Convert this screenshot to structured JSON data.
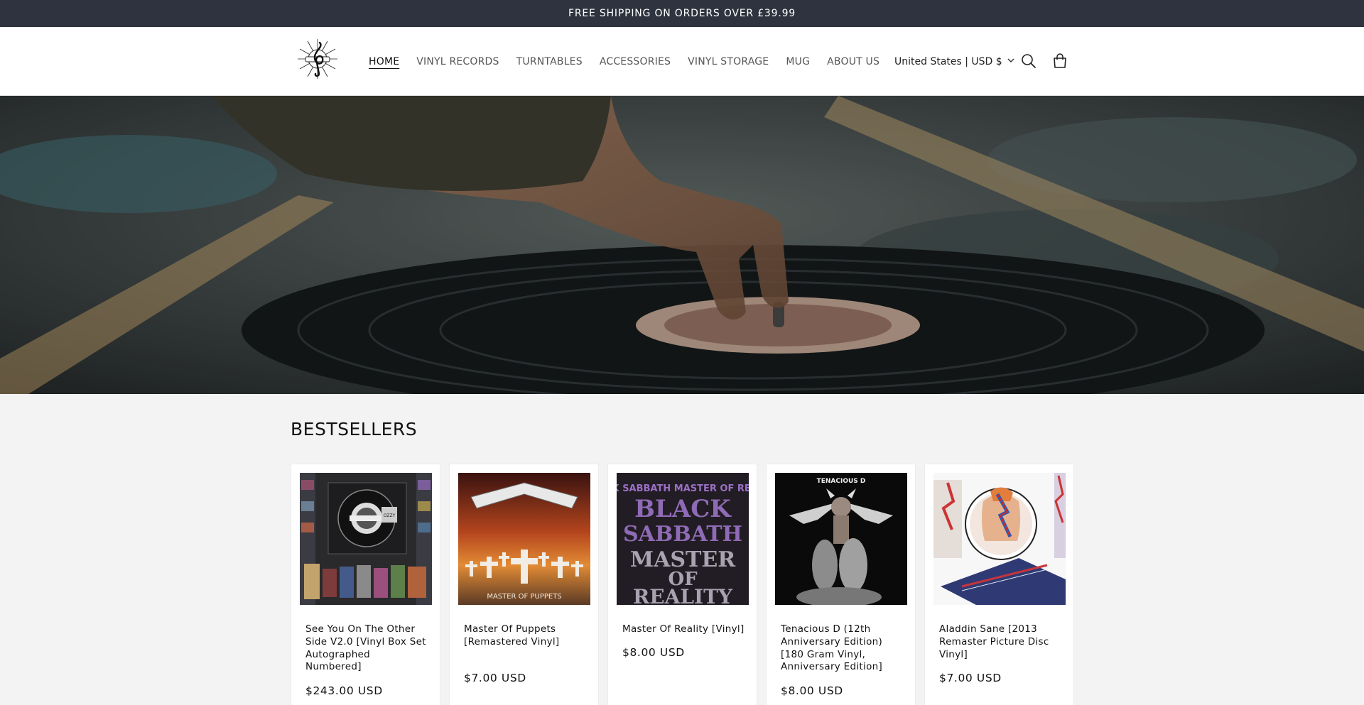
{
  "announcement": "FREE SHIPPING ON ORDERS OVER £39.99",
  "nav": {
    "items": [
      {
        "label": "HOME",
        "active": true
      },
      {
        "label": "VINYL RECORDS"
      },
      {
        "label": "TURNTABLES"
      },
      {
        "label": "ACCESSORIES"
      },
      {
        "label": "VINYL STORAGE"
      },
      {
        "label": "MUG"
      },
      {
        "label": "ABOUT US"
      }
    ]
  },
  "header": {
    "country": "United States | USD $",
    "icons": [
      "music-note-logo",
      "chevron-down-icon",
      "search-icon",
      "cart-icon"
    ]
  },
  "bestsellers": {
    "heading": "BESTSELLERS",
    "products": [
      {
        "title": "See You On The Other Side V2.0 [Vinyl Box Set Autographed Numbered]",
        "price": "$243.00 USD",
        "cover_text": "OZZY"
      },
      {
        "title": "Master Of Puppets [Remastered Vinyl]",
        "price": "$7.00 USD",
        "cover_text": "MASTER OF PUPPETS"
      },
      {
        "title": "Master Of Reality [Vinyl]",
        "price": "$8.00 USD",
        "cover_text": "BLACK SABBATH MASTER OF REALITY"
      },
      {
        "title": "Tenacious D (12th Anniversary Edition) [180 Gram Vinyl, Anniversary Edition]",
        "price": "$8.00 USD",
        "cover_text": "TENACIOUS D"
      },
      {
        "title": "Aladdin Sane [2013 Remaster Picture Disc Vinyl]",
        "price": "$7.00 USD",
        "cover_text": ""
      }
    ]
  },
  "colors": {
    "announce_bg": "#2e333f",
    "page_bg": "#f3f3f3",
    "text": "#121212"
  }
}
